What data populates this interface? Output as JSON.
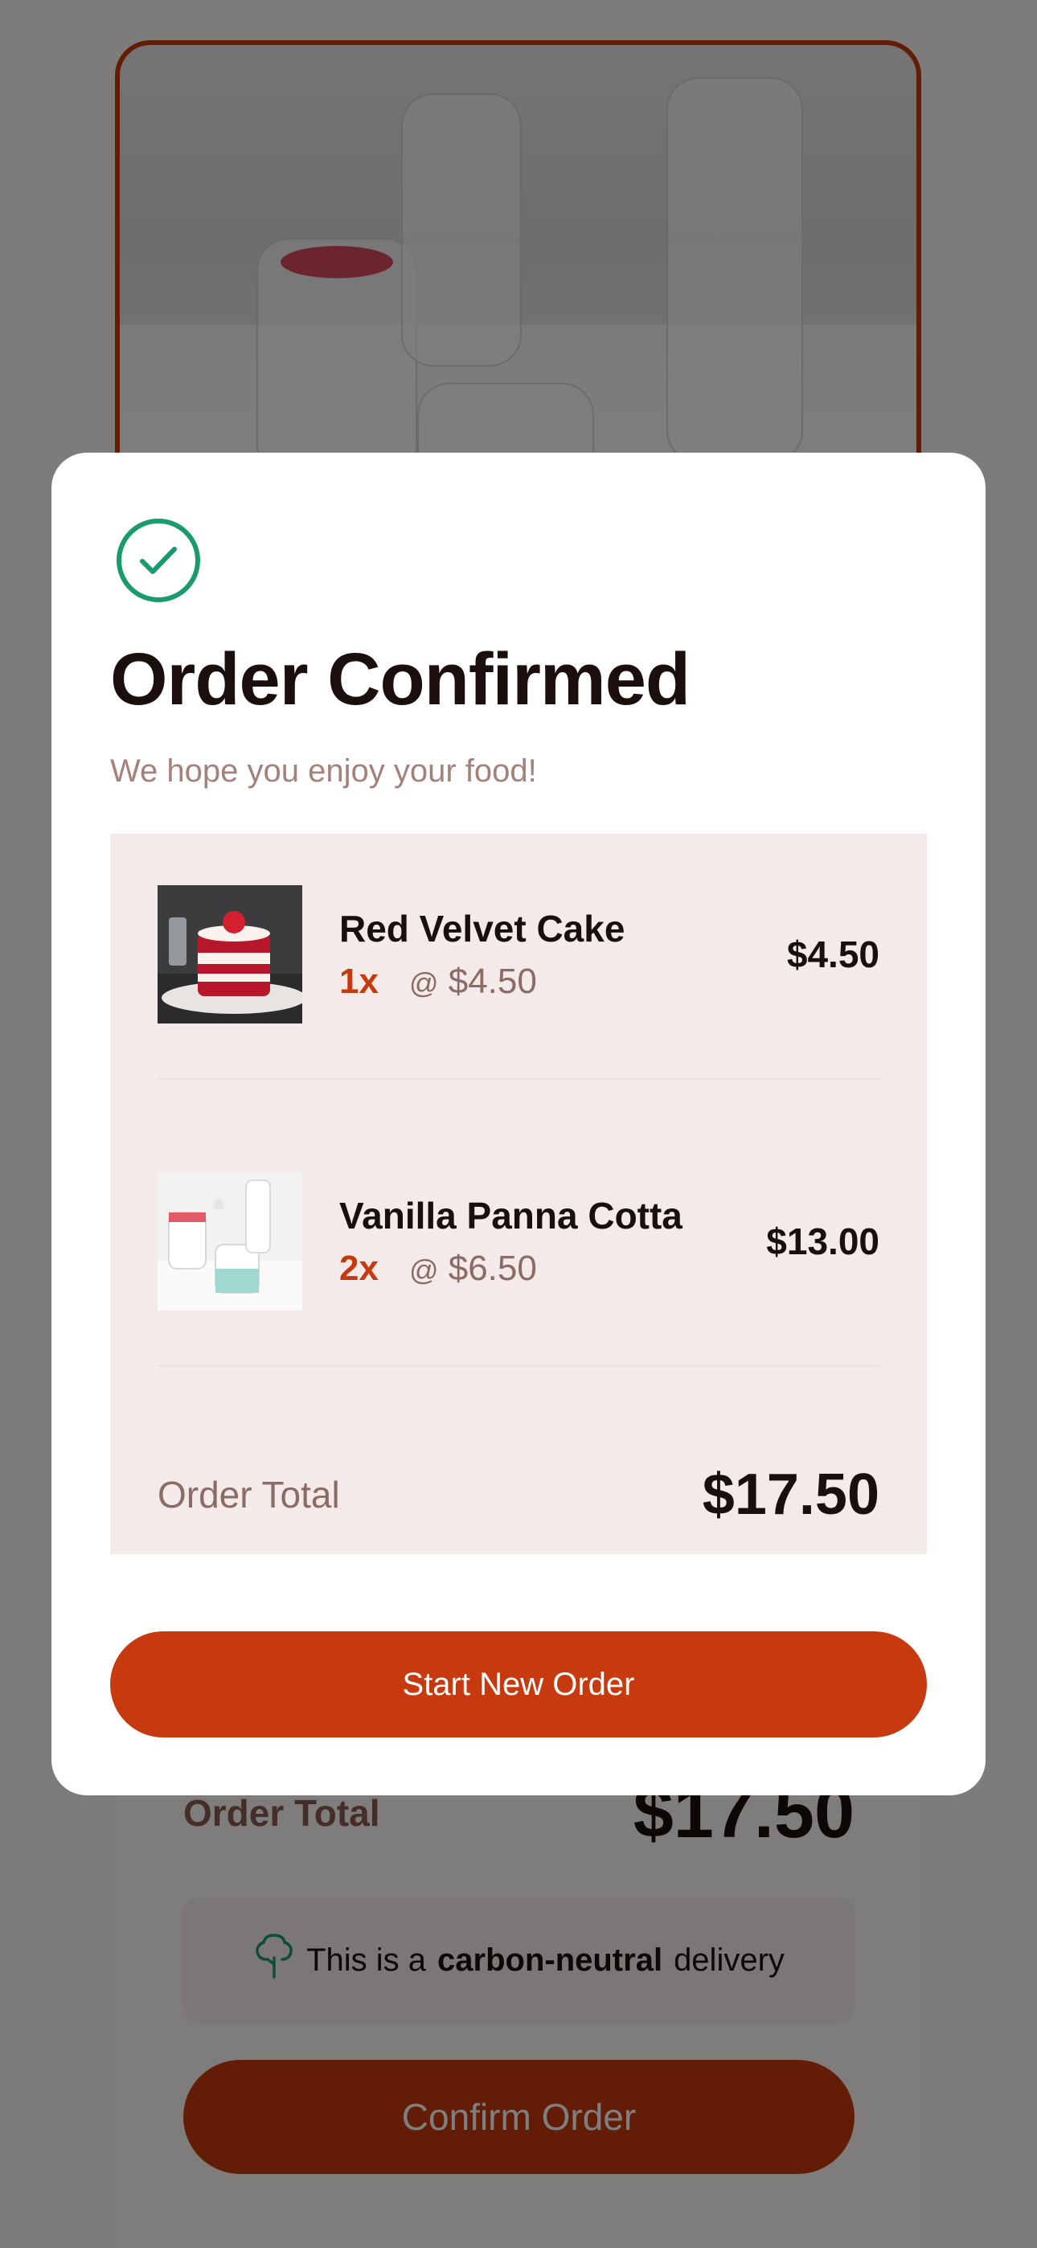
{
  "background": {
    "total_label": "Order Total",
    "total_value": "$17.50",
    "carbon": {
      "prefix": "This is a",
      "emphasis": "carbon-neutral",
      "suffix": "delivery",
      "icon": "tree-icon"
    },
    "confirm_label": "Confirm Order"
  },
  "modal": {
    "icon": "check-circle-icon",
    "title": "Order Confirmed",
    "subtitle": "We hope you enjoy your food!",
    "items": [
      {
        "name": "Red Velvet Cake",
        "qty": "1x",
        "unit_price": "$4.50",
        "price": "$4.50",
        "image": "red-velvet-cake-image"
      },
      {
        "name": "Vanilla Panna Cotta",
        "qty": "2x",
        "unit_price": "$6.50",
        "price": "$13.00",
        "image": "panna-cotta-image"
      }
    ],
    "at_symbol": "@",
    "total_label": "Order Total",
    "total_value": "$17.50",
    "button_label": "Start New Order"
  },
  "colors": {
    "accent": "#c73a0f",
    "success": "#1a9b6c",
    "box": "#f4eaea",
    "text": "#1b0f0d"
  }
}
